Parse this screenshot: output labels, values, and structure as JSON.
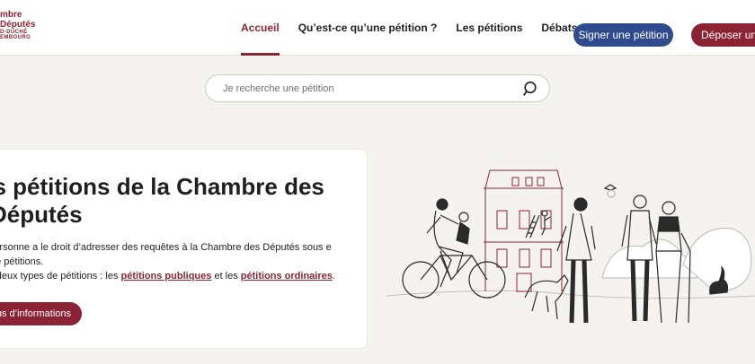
{
  "logo": {
    "line1": "mbre",
    "line2": "Députés",
    "line3": "D-DUCHÉ",
    "line4": "EMBOURG",
    "color": "#8c2334"
  },
  "nav": {
    "items": [
      {
        "label": "Accueil",
        "active": true
      },
      {
        "label": "Qu’est-ce qu’une pétition ?",
        "active": false
      },
      {
        "label": "Les pétitions",
        "active": false
      },
      {
        "label": "Débats publics",
        "active": false
      }
    ]
  },
  "actions": {
    "sign_label": "Signer une pétition",
    "sign_color": "#2f4b8e",
    "depose_label": "Déposer une",
    "depose_color": "#8c2334"
  },
  "search": {
    "placeholder": "Je recherche une pétition",
    "value": ""
  },
  "hero": {
    "title": "es pétitions de la Chambre des Députés",
    "text1": "e personne a le droit d’adresser des requêtes à la Chambre des Députés sous e de pétitions.",
    "text2_prefix": "ste deux types de pétitions : les ",
    "link_public": "pétitions publiques",
    "text2_mid": " et les ",
    "link_ordinary": "pétitions ordinaires",
    "text2_suffix": ".",
    "more_label": "us d’informations"
  },
  "icons": {
    "search": "search-icon",
    "illustration": "people-building-illustration"
  }
}
